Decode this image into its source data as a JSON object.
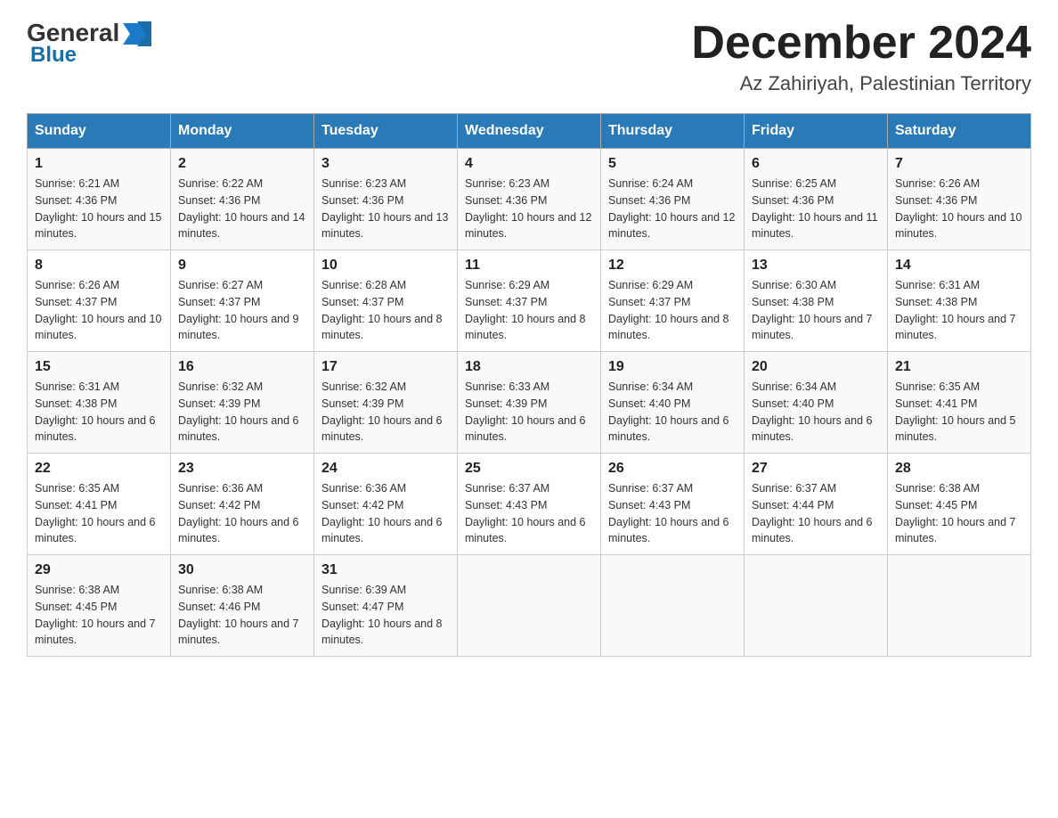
{
  "header": {
    "logo_general": "General",
    "logo_blue": "Blue",
    "title": "December 2024",
    "subtitle": "Az Zahiriyah, Palestinian Territory"
  },
  "calendar": {
    "days_of_week": [
      "Sunday",
      "Monday",
      "Tuesday",
      "Wednesday",
      "Thursday",
      "Friday",
      "Saturday"
    ],
    "weeks": [
      [
        {
          "day": "1",
          "sunrise": "6:21 AM",
          "sunset": "4:36 PM",
          "daylight": "10 hours and 15 minutes."
        },
        {
          "day": "2",
          "sunrise": "6:22 AM",
          "sunset": "4:36 PM",
          "daylight": "10 hours and 14 minutes."
        },
        {
          "day": "3",
          "sunrise": "6:23 AM",
          "sunset": "4:36 PM",
          "daylight": "10 hours and 13 minutes."
        },
        {
          "day": "4",
          "sunrise": "6:23 AM",
          "sunset": "4:36 PM",
          "daylight": "10 hours and 12 minutes."
        },
        {
          "day": "5",
          "sunrise": "6:24 AM",
          "sunset": "4:36 PM",
          "daylight": "10 hours and 12 minutes."
        },
        {
          "day": "6",
          "sunrise": "6:25 AM",
          "sunset": "4:36 PM",
          "daylight": "10 hours and 11 minutes."
        },
        {
          "day": "7",
          "sunrise": "6:26 AM",
          "sunset": "4:36 PM",
          "daylight": "10 hours and 10 minutes."
        }
      ],
      [
        {
          "day": "8",
          "sunrise": "6:26 AM",
          "sunset": "4:37 PM",
          "daylight": "10 hours and 10 minutes."
        },
        {
          "day": "9",
          "sunrise": "6:27 AM",
          "sunset": "4:37 PM",
          "daylight": "10 hours and 9 minutes."
        },
        {
          "day": "10",
          "sunrise": "6:28 AM",
          "sunset": "4:37 PM",
          "daylight": "10 hours and 8 minutes."
        },
        {
          "day": "11",
          "sunrise": "6:29 AM",
          "sunset": "4:37 PM",
          "daylight": "10 hours and 8 minutes."
        },
        {
          "day": "12",
          "sunrise": "6:29 AM",
          "sunset": "4:37 PM",
          "daylight": "10 hours and 8 minutes."
        },
        {
          "day": "13",
          "sunrise": "6:30 AM",
          "sunset": "4:38 PM",
          "daylight": "10 hours and 7 minutes."
        },
        {
          "day": "14",
          "sunrise": "6:31 AM",
          "sunset": "4:38 PM",
          "daylight": "10 hours and 7 minutes."
        }
      ],
      [
        {
          "day": "15",
          "sunrise": "6:31 AM",
          "sunset": "4:38 PM",
          "daylight": "10 hours and 6 minutes."
        },
        {
          "day": "16",
          "sunrise": "6:32 AM",
          "sunset": "4:39 PM",
          "daylight": "10 hours and 6 minutes."
        },
        {
          "day": "17",
          "sunrise": "6:32 AM",
          "sunset": "4:39 PM",
          "daylight": "10 hours and 6 minutes."
        },
        {
          "day": "18",
          "sunrise": "6:33 AM",
          "sunset": "4:39 PM",
          "daylight": "10 hours and 6 minutes."
        },
        {
          "day": "19",
          "sunrise": "6:34 AM",
          "sunset": "4:40 PM",
          "daylight": "10 hours and 6 minutes."
        },
        {
          "day": "20",
          "sunrise": "6:34 AM",
          "sunset": "4:40 PM",
          "daylight": "10 hours and 6 minutes."
        },
        {
          "day": "21",
          "sunrise": "6:35 AM",
          "sunset": "4:41 PM",
          "daylight": "10 hours and 5 minutes."
        }
      ],
      [
        {
          "day": "22",
          "sunrise": "6:35 AM",
          "sunset": "4:41 PM",
          "daylight": "10 hours and 6 minutes."
        },
        {
          "day": "23",
          "sunrise": "6:36 AM",
          "sunset": "4:42 PM",
          "daylight": "10 hours and 6 minutes."
        },
        {
          "day": "24",
          "sunrise": "6:36 AM",
          "sunset": "4:42 PM",
          "daylight": "10 hours and 6 minutes."
        },
        {
          "day": "25",
          "sunrise": "6:37 AM",
          "sunset": "4:43 PM",
          "daylight": "10 hours and 6 minutes."
        },
        {
          "day": "26",
          "sunrise": "6:37 AM",
          "sunset": "4:43 PM",
          "daylight": "10 hours and 6 minutes."
        },
        {
          "day": "27",
          "sunrise": "6:37 AM",
          "sunset": "4:44 PM",
          "daylight": "10 hours and 6 minutes."
        },
        {
          "day": "28",
          "sunrise": "6:38 AM",
          "sunset": "4:45 PM",
          "daylight": "10 hours and 7 minutes."
        }
      ],
      [
        {
          "day": "29",
          "sunrise": "6:38 AM",
          "sunset": "4:45 PM",
          "daylight": "10 hours and 7 minutes."
        },
        {
          "day": "30",
          "sunrise": "6:38 AM",
          "sunset": "4:46 PM",
          "daylight": "10 hours and 7 minutes."
        },
        {
          "day": "31",
          "sunrise": "6:39 AM",
          "sunset": "4:47 PM",
          "daylight": "10 hours and 8 minutes."
        },
        null,
        null,
        null,
        null
      ]
    ]
  }
}
